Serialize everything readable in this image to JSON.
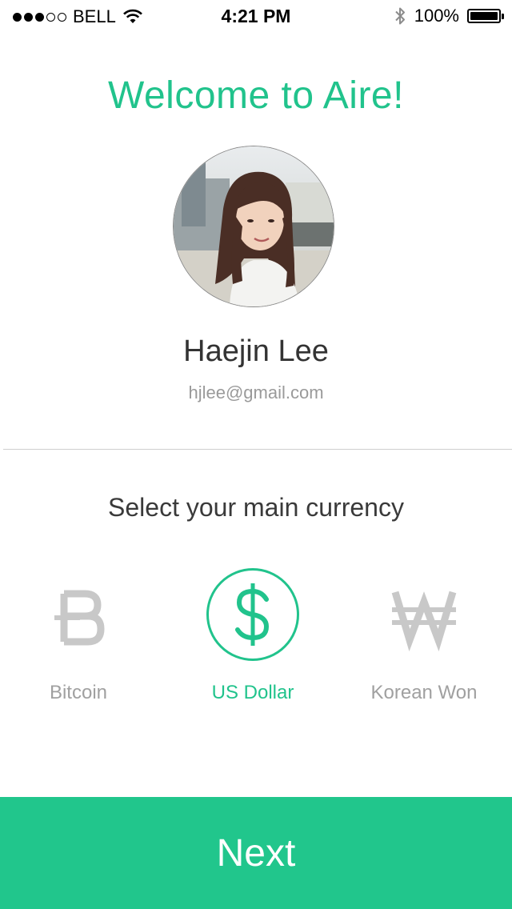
{
  "status_bar": {
    "carrier": "BELL",
    "signal_bars_filled": 3,
    "signal_bars_total": 5,
    "time": "4:21 PM",
    "battery_percent": "100%",
    "icons": [
      "signal-dots-icon",
      "wifi-icon",
      "bluetooth-icon",
      "battery-icon"
    ]
  },
  "header": {
    "title": "Welcome to Aire!"
  },
  "profile": {
    "name": "Haejin Lee",
    "email": "hjlee@gmail.com"
  },
  "currency": {
    "title": "Select your main currency",
    "options": [
      {
        "label": "Bitcoin",
        "symbol": "Ƀ",
        "icon": "bitcoin-icon",
        "selected": false
      },
      {
        "label": "US Dollar",
        "symbol": "$",
        "icon": "dollar-icon",
        "selected": true
      },
      {
        "label": "Korean Won",
        "symbol": "₩",
        "icon": "won-icon",
        "selected": false
      }
    ]
  },
  "footer": {
    "next_label": "Next"
  },
  "colors": {
    "accent": "#21c38c",
    "inactive": "#c8c8c8",
    "text_dark": "#333333",
    "text_muted": "#9a9a9a"
  }
}
